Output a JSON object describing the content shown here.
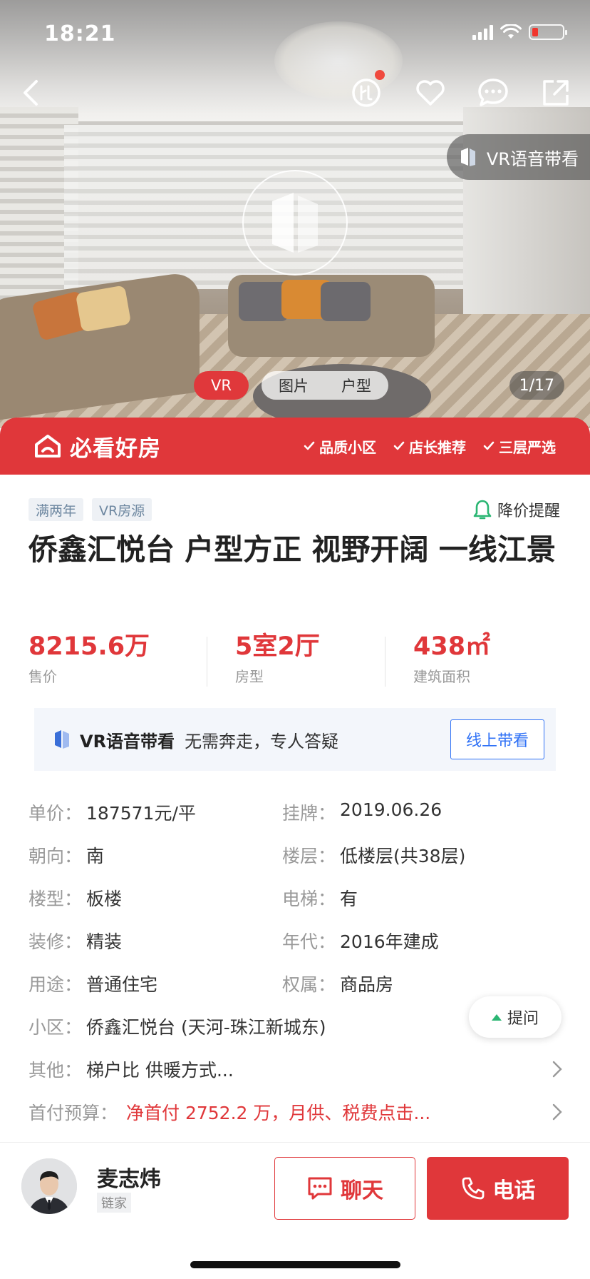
{
  "status_bar": {
    "time": "18:21",
    "battery_level": 0.1
  },
  "hero": {
    "vr_guide_label": "VR语音带看",
    "tabs": [
      "VR",
      "图片",
      "户型"
    ],
    "counter": "1/17"
  },
  "banner": {
    "brand": "必看好房",
    "tags": [
      "品质小区",
      "店长推荐",
      "三层严选"
    ]
  },
  "listing": {
    "tags": [
      "满两年",
      "VR房源"
    ],
    "price_alert": "降价提醒",
    "title": "侨鑫汇悦台 户型方正 视野开阔 一线江景",
    "stats": [
      {
        "value": "8215.6万",
        "label": "售价"
      },
      {
        "value": "5室2厅",
        "label": "房型"
      },
      {
        "value": "438㎡",
        "label": "建筑面积"
      }
    ]
  },
  "vr_bar": {
    "title": "VR语音带看",
    "subtitle": "无需奔走，专人答疑",
    "button": "线上带看"
  },
  "info": [
    [
      {
        "label": "单价：",
        "value": "187571元/平"
      },
      {
        "label": "挂牌：",
        "value": "2019.06.26"
      }
    ],
    [
      {
        "label": "朝向：",
        "value": "南"
      },
      {
        "label": "楼层：",
        "value": "低楼层(共38层)"
      }
    ],
    [
      {
        "label": "楼型：",
        "value": "板楼"
      },
      {
        "label": "电梯：",
        "value": "有"
      }
    ],
    [
      {
        "label": "装修：",
        "value": "精装"
      },
      {
        "label": "年代：",
        "value": "2016年建成"
      }
    ],
    [
      {
        "label": "用途：",
        "value": "普通住宅"
      },
      {
        "label": "权属：",
        "value": "商品房"
      }
    ]
  ],
  "community": {
    "label": "小区：",
    "value": "侨鑫汇悦台 (天河-珠江新城东)"
  },
  "other": {
    "label": "其他：",
    "value": "梯户比 供暖方式..."
  },
  "downpayment": {
    "label": "首付预算：",
    "value": "净首付 2752.2 万，月供、税费点击..."
  },
  "ask_button": "提问",
  "agent": {
    "name": "麦志炜",
    "brand": "链家",
    "chat_label": "聊天",
    "call_label": "电话"
  },
  "colors": {
    "accent": "#e0373a",
    "blue": "#3072f6"
  }
}
